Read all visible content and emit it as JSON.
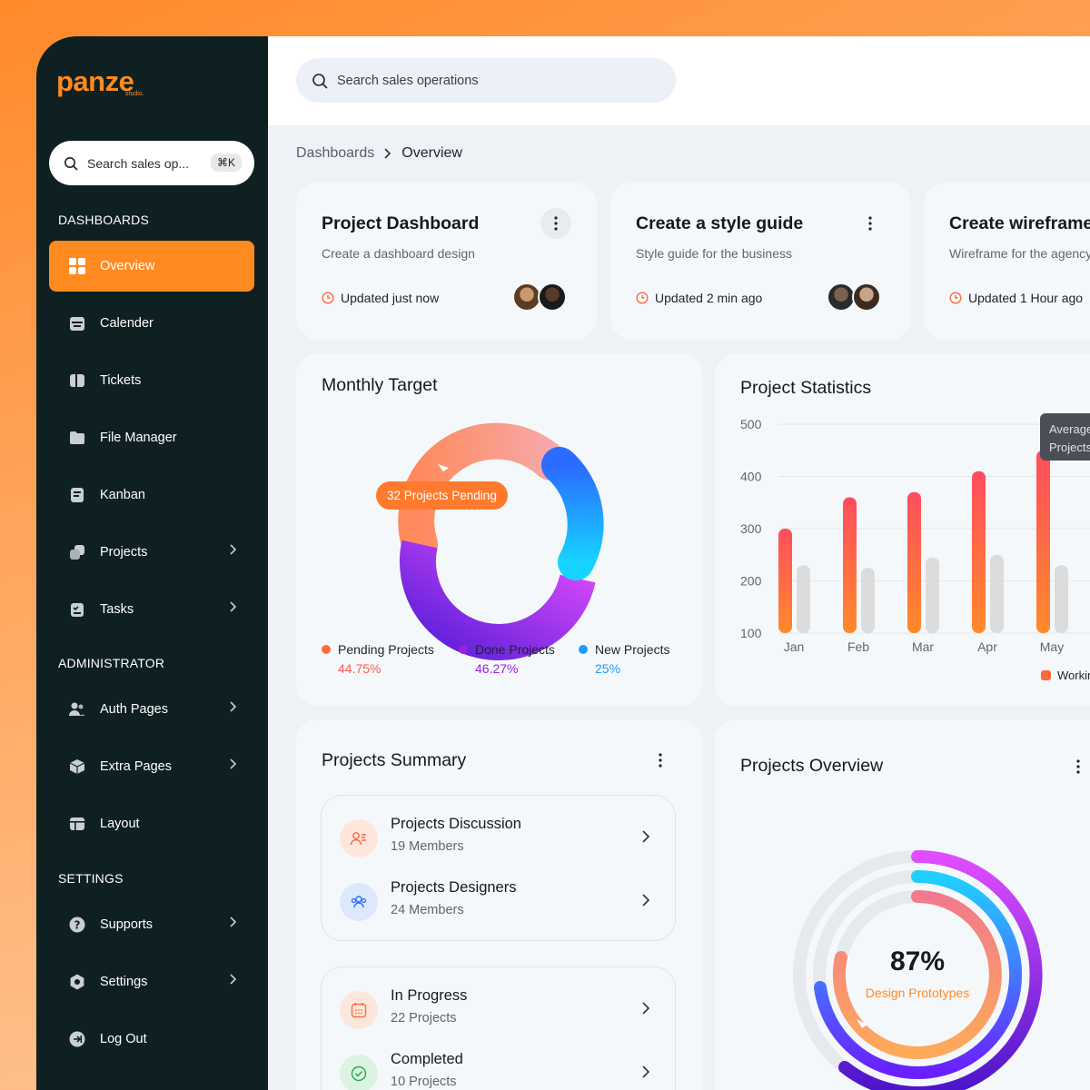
{
  "brand": {
    "logo": "panze",
    "logo_sub": "studio."
  },
  "sidebar": {
    "search_placeholder": "Search sales op...",
    "search_shortcut": "⌘K",
    "sections": {
      "dashboards": "DASHBOARDS",
      "administrator": "ADMINISTRATOR",
      "settings": "SETTINGS"
    },
    "items": [
      {
        "label": "Overview",
        "icon": "grid-icon",
        "active": true
      },
      {
        "label": "Calender",
        "icon": "calendar-icon"
      },
      {
        "label": "Tickets",
        "icon": "ticket-icon"
      },
      {
        "label": "File Manager",
        "icon": "folder-icon"
      },
      {
        "label": "Kanban",
        "icon": "kanban-icon"
      },
      {
        "label": "Projects",
        "icon": "projects-icon",
        "has_children": true
      },
      {
        "label": "Tasks",
        "icon": "tasks-icon",
        "has_children": true
      },
      {
        "label": "Auth Pages",
        "icon": "users-icon",
        "has_children": true
      },
      {
        "label": "Extra Pages",
        "icon": "box-icon",
        "has_children": true
      },
      {
        "label": "Layout",
        "icon": "layout-icon"
      },
      {
        "label": "Supports",
        "icon": "help-icon",
        "has_children": true
      },
      {
        "label": "Settings",
        "icon": "gear-icon",
        "has_children": true
      },
      {
        "label": "Log Out",
        "icon": "logout-icon"
      }
    ]
  },
  "topbar": {
    "search_placeholder": "Search sales operations"
  },
  "breadcrumb": {
    "parent": "Dashboards",
    "current": "Overview"
  },
  "task_cards": [
    {
      "title": "Project Dashboard",
      "subtitle": "Create a dashboard design",
      "updated": "Updated just now"
    },
    {
      "title": "Create a style guide",
      "subtitle": "Style guide for the business",
      "updated": "Updated 2 min ago"
    },
    {
      "title": "Create wireframe",
      "subtitle": "Wireframe for the agency",
      "updated": "Updated 1 Hour ago"
    }
  ],
  "monthly_target": {
    "title": "Monthly Target",
    "pending_tag": "32 Projects Pending",
    "legend": [
      {
        "label": "Pending Projects",
        "value": "44.75%",
        "color": "#ff6a3d"
      },
      {
        "label": "Done Projects",
        "value": "46.27%",
        "color": "#9b1fe0"
      },
      {
        "label": "New Projects",
        "value": "25%",
        "color": "#1e9bff"
      }
    ]
  },
  "project_statistics": {
    "title": "Project Statistics",
    "tooltip_line1": "Average",
    "tooltip_line2": "Projects",
    "legend_label": "Working",
    "chart_data": {
      "type": "bar",
      "categories": [
        "Jan",
        "Feb",
        "Mar",
        "Apr",
        "May"
      ],
      "series": [
        {
          "values": [
            300,
            360,
            370,
            410,
            450
          ],
          "color": "#ff6a3d"
        },
        {
          "values": [
            230,
            225,
            245,
            250,
            230
          ],
          "color": "#dcdcdc"
        }
      ],
      "yticks": [
        100,
        200,
        300,
        400,
        500
      ],
      "ylim": [
        100,
        500
      ]
    }
  },
  "projects_summary": {
    "title": "Projects Summary",
    "groups": [
      [
        {
          "title": "Projects Discussion",
          "subtitle": "19 Members",
          "icon": "user-list-icon"
        },
        {
          "title": "Projects Designers",
          "subtitle": "24 Members",
          "icon": "team-icon"
        }
      ],
      [
        {
          "title": "In Progress",
          "subtitle": "22 Projects",
          "icon": "calendar-grid-icon"
        },
        {
          "title": "Completed",
          "subtitle": "10 Projects",
          "icon": "check-circle-icon"
        }
      ]
    ]
  },
  "projects_overview": {
    "title": "Projects Overview",
    "percent": "87%",
    "label": "Design Prototypes"
  }
}
